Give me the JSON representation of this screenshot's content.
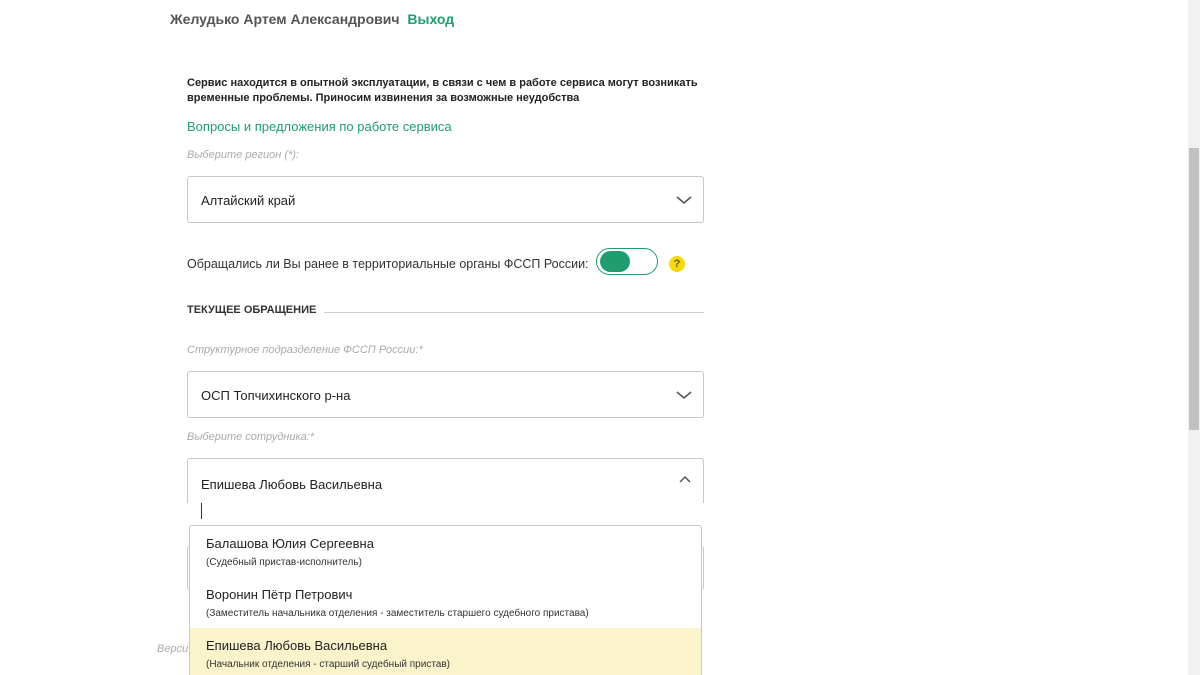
{
  "user": {
    "name": "Желудько Артем Александрович",
    "logout_label": "Выход"
  },
  "notice": {
    "line1": "Сервис находится в опытной эксплуатации, в связи с чем в работе сервиса могут возникать",
    "line2": "временные проблемы. Приносим извинения за возможные неудобства"
  },
  "feedback_link": "Вопросы и предложения по работе сервиса",
  "region": {
    "label": "Выберите регион (*):",
    "value": "Алтайский край"
  },
  "prior_contact": {
    "question": "Обращались ли Вы ранее в территориальные органы ФССП России:",
    "toggle_on": true,
    "help_icon": "?"
  },
  "current_appeal": {
    "section_title": "ТЕКУЩЕЕ ОБРАЩЕНИЕ",
    "division_label": "Структурное подразделение ФССП России:*",
    "division_value": "ОСП Топчихинского р-на",
    "employee_label": "Выберите сотрудника:*",
    "employee_value": "Епишева Любовь Васильевна"
  },
  "employee_options": [
    {
      "name": "Балашова Юлия Сергеевна",
      "role": "(Судебный пристав-исполнитель)",
      "selected": false
    },
    {
      "name": "Воронин Пётр Петрович",
      "role": "(Заместитель начальника отделения - заместитель старшего судебного пристава)",
      "selected": false
    },
    {
      "name": "Епишева Любовь Васильевна",
      "role": "(Начальник отделения - старший судебный пристав)",
      "selected": true
    }
  ],
  "footer": {
    "version_partial": "Верси"
  },
  "colors": {
    "accent": "#1f9d6e",
    "selected_option_bg": "#faf3cc",
    "help_icon_bg": "#f5d90a"
  }
}
